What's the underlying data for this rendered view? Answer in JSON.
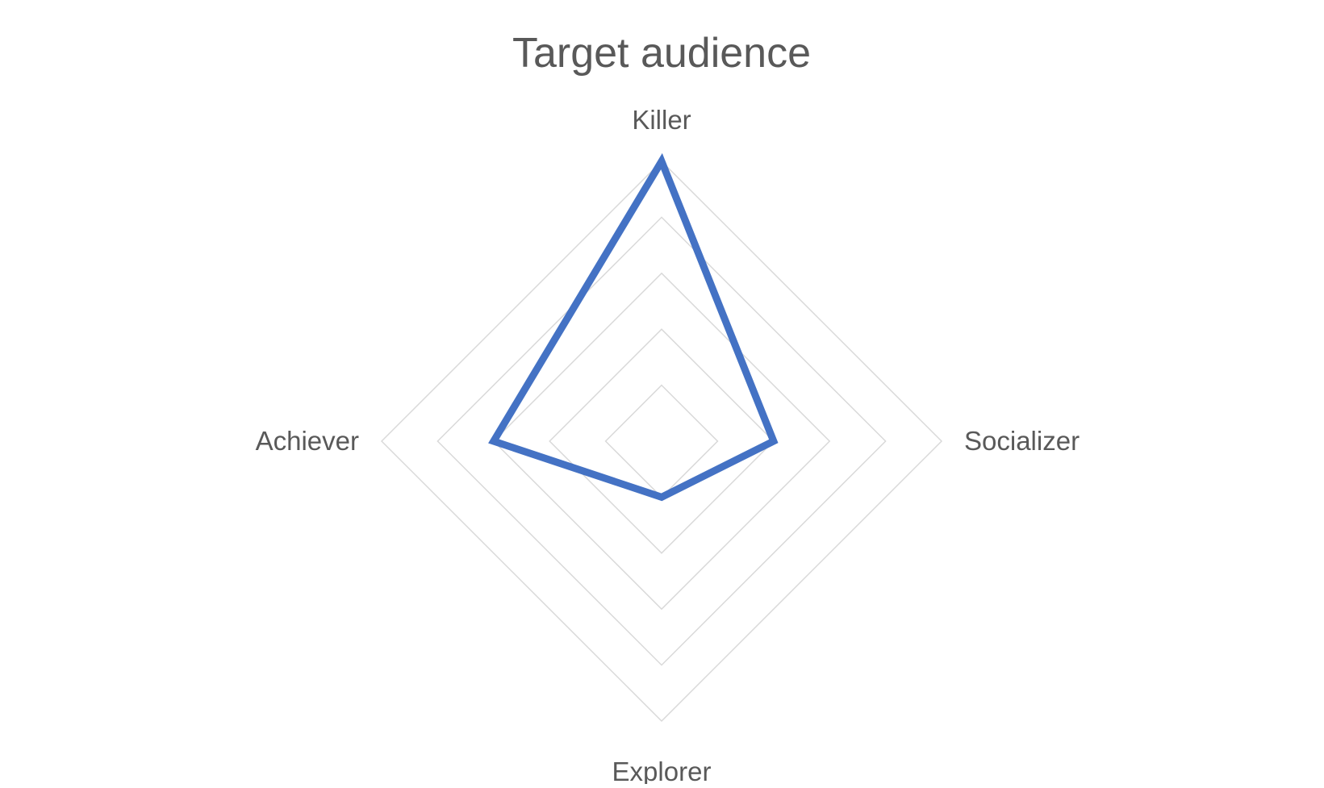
{
  "chart_data": {
    "type": "radar",
    "title": "Target audience",
    "categories": [
      "Killer",
      "Socializer",
      "Explorer",
      "Achiever"
    ],
    "series": [
      {
        "values": [
          5,
          2,
          1,
          3
        ]
      }
    ],
    "rlim": [
      0,
      5
    ],
    "grid_rings": 5,
    "grid": true,
    "legend": false
  },
  "colors": {
    "series": "#4472C4",
    "grid": "#d9d9d9",
    "text": "#595959"
  }
}
